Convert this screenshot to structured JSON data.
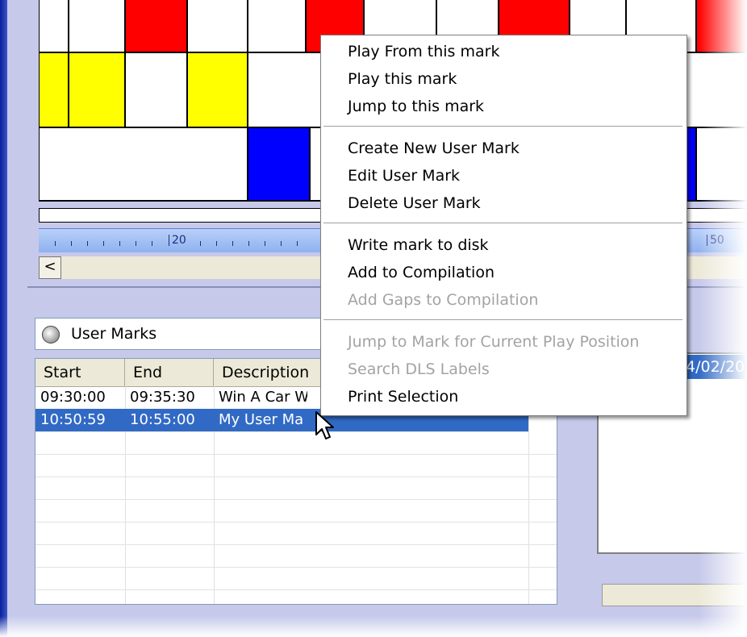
{
  "timeline": {
    "ruler_labels": [
      "20",
      "50"
    ],
    "scroll_left_glyph": "<"
  },
  "user_marks": {
    "title": "User Marks",
    "columns": [
      "Start",
      "End",
      "Description"
    ],
    "rows": [
      {
        "start": "09:30:00",
        "end": "09:35:30",
        "description": "Win A Car W",
        "selected": false
      },
      {
        "start": "10:50:59",
        "end": "10:55:00",
        "description": "My User Ma",
        "selected": true
      }
    ]
  },
  "right_panel": {
    "date_partial": "4/02/20"
  },
  "context_menu": {
    "items": [
      {
        "label": "Play From this mark",
        "enabled": true
      },
      {
        "label": "Play this mark",
        "enabled": true
      },
      {
        "label": "Jump to this mark",
        "enabled": true
      },
      {
        "label": "Create New User Mark",
        "enabled": true
      },
      {
        "label": "Edit User Mark",
        "enabled": true
      },
      {
        "label": "Delete User Mark",
        "enabled": true
      },
      {
        "label": "Write mark to disk",
        "enabled": true
      },
      {
        "label": "Add to Compilation",
        "enabled": true
      },
      {
        "label": "Add Gaps to Compilation",
        "enabled": false
      },
      {
        "label": "Jump to Mark for Current Play Position",
        "enabled": false
      },
      {
        "label": "Search DLS Labels",
        "enabled": false
      },
      {
        "label": "Print Selection",
        "enabled": true
      }
    ]
  },
  "colors": {
    "mark_red": "#ff0000",
    "mark_yellow": "#ffff00",
    "mark_blue": "#0000ff",
    "selection": "#316ac5",
    "panel_background": "#c6c9ea"
  }
}
